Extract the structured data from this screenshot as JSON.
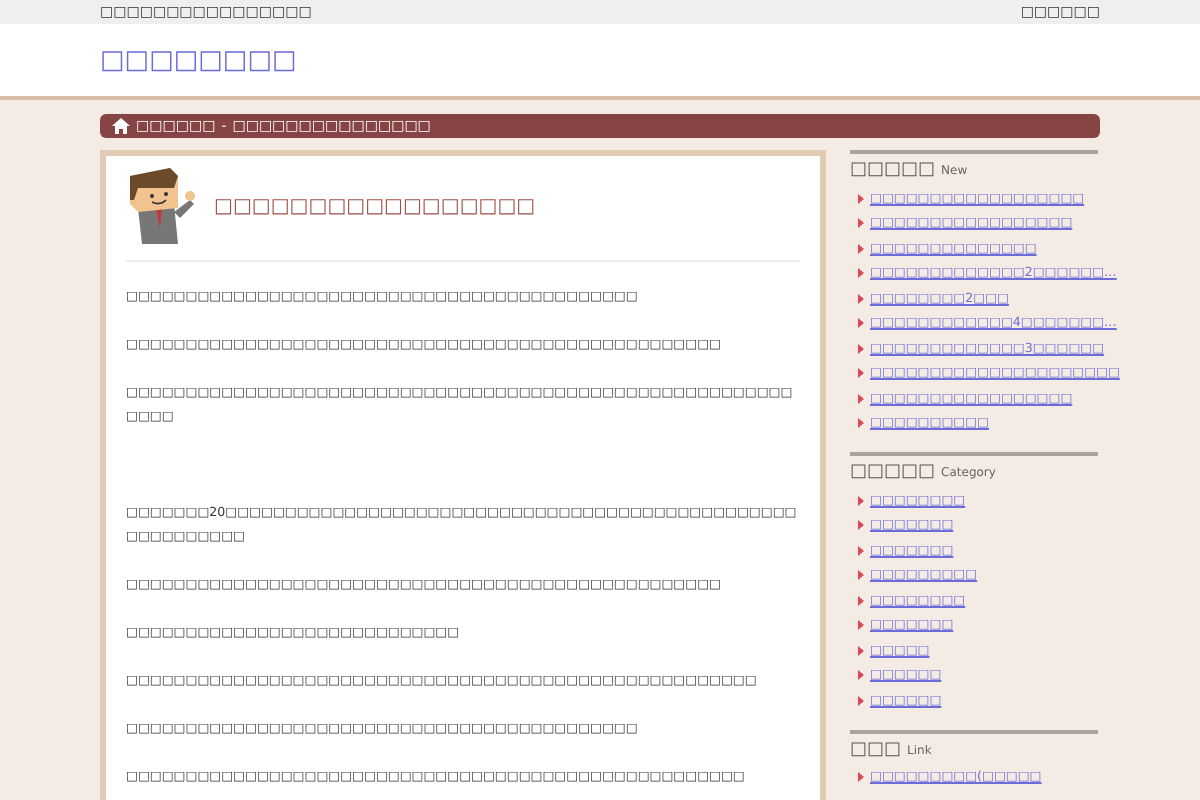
{
  "top_bar": {
    "tagline": "□□□□□□□□□□□□□□□□",
    "right_text": "□□□□□□"
  },
  "site_title": "□□□□□□□□",
  "breadcrumb": {
    "home": "□□□□□□",
    "separator": "-",
    "current": "□□□□□□□□□□□□□□□"
  },
  "post": {
    "title": "□□□□□□□□□□□□□□□□□",
    "paragraphs": [
      "□□□□□□□□□□□□□□□□□□□□□□□□□□□□□□□□□□□□□□□□□□□",
      "□□□□□□□□□□□□□□□□□□□□□□□□□□□□□□□□□□□□□□□□□□□□□□□□□□",
      "□□□□□□□□□□□□□□□□□□□□□□□□□□□□□□□□□□□□□□□□□□□□□□□□□□□□□□□□□□□□",
      "□□□□□□□20□□□□□□□□□□□□□□□□□□□□□□□□□□□□□□□□□□□□□□□□□□□□□□□□□□□□□□□□□□",
      "□□□□□□□□□□□□□□□□□□□□□□□□□□□□□□□□□□□□□□□□□□□□□□□□□□",
      "□□□□□□□□□□□□□□□□□□□□□□□□□□□□",
      "□□□□□□□□□□□□□□□□□□□□□□□□□□□□□□□□□□□□□□□□□□□□□□□□□□□□□",
      "□□□□□□□□□□□□□□□□□□□□□□□□□□□□□□□□□□□□□□□□□□□",
      "□□□□□□□□□□□□□□□□□□□□□□□□□□□□□□□□□□□□□□□□□□□□□□□□□□□□"
    ]
  },
  "sidebar": [
    {
      "title": "□□□□□",
      "subtitle": "New",
      "items": [
        "□□□□□□□□□□□□□□□□□□",
        "□□□□□□□□□□□□□□□□□",
        "□□□□□□□□□□□□□□",
        "□□□□□□□□□□□□□2□□□□□□…",
        "□□□□□□□□2□□□",
        "□□□□□□□□□□□□4□□□□□□□…",
        "□□□□□□□□□□□□□3□□□□□□",
        "□□□□□□□□□□□□□□□□□□□□□",
        "□□□□□□□□□□□□□□□□□",
        "□□□□□□□□□□"
      ]
    },
    {
      "title": "□□□□□",
      "subtitle": "Category",
      "items": [
        "□□□□□□□□",
        "□□□□□□□",
        "□□□□□□□",
        "□□□□□□□□□",
        "□□□□□□□□",
        "□□□□□□□",
        "□□□□□",
        "□□□□□□",
        "□□□□□□"
      ]
    },
    {
      "title": "□□□",
      "subtitle": "Link",
      "items": [
        "□□□□□□□□□(□□□□□"
      ]
    }
  ]
}
